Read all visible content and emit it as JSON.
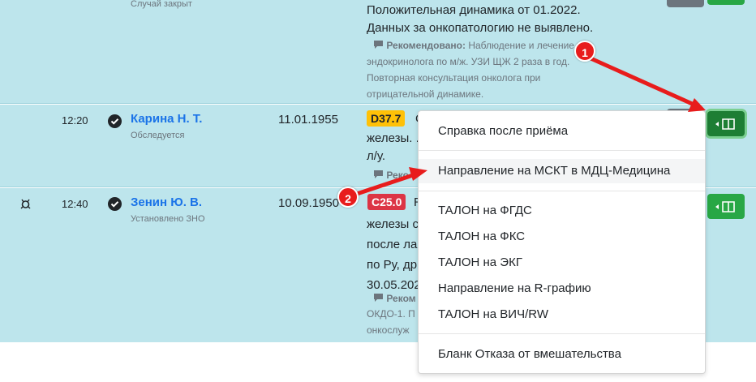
{
  "colors": {
    "row_bg": "#bde5ec",
    "link": "#1a73e8",
    "green_btn": "#28a745",
    "badge_yellow": "#ffc107",
    "badge_red": "#dc3545",
    "annotation": "#e81c1c"
  },
  "rows": [
    {
      "status": "Случай закрыт",
      "diagnosis_lines": [
        "Положительная динамика от 01.2022.",
        "Данных за онкопатологию не выявлено."
      ],
      "recommendation_label": "Рекомендовано:",
      "recommendation_lines": [
        "Наблюдение и лечение у",
        "эндокринолога по м/ж. УЗИ ЩЖ 2 раза в год.",
        "Повторная консультация онколога при",
        "отрицательной динамике."
      ]
    },
    {
      "time": "12:20",
      "name": "Карина Н. Т.",
      "status": "Обследуется",
      "dob": "11.01.1955",
      "code": "D37.7",
      "diagnosis_lines": [
        "С",
        "железы. .",
        "л/у."
      ],
      "recommendation_label": "Реко"
    },
    {
      "time": "12:40",
      "name": "Зенин Ю. В.",
      "status": "Установлено ЗНО",
      "dob": "10.09.1950",
      "code": "C25.0",
      "diagnosis_lines": [
        "R",
        "железы с",
        "после ла",
        "по Ру, др",
        "30.05.202"
      ],
      "recommendation_label": "Реком",
      "recommendation_lines": [
        "ОКДО-1. П",
        "онкослуж"
      ]
    }
  ],
  "dropdown": {
    "items": [
      "Справка после приёма",
      "Направление на МСКТ в МДЦ-Медицина",
      "ТАЛОН на ФГДС",
      "ТАЛОН на ФКС",
      "ТАЛОН на ЭКГ",
      "Направление на R-графию",
      "ТАЛОН на ВИЧ/RW",
      "Бланк Отказа от вмешательства"
    ]
  },
  "annotations": [
    "1",
    "2"
  ],
  "icons": [
    "check-circle-icon",
    "comment-icon",
    "book-icon",
    "caret-left-icon",
    "patient-flag-icon"
  ]
}
